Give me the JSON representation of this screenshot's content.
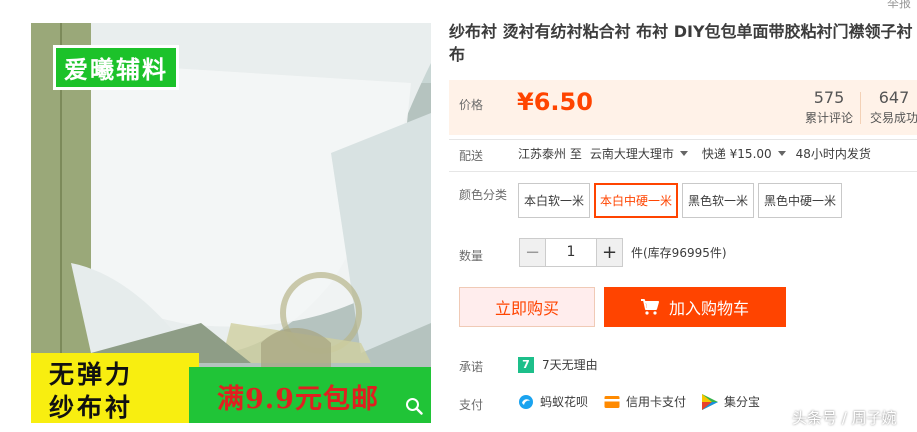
{
  "header": {
    "report_link": "举报"
  },
  "gallery": {
    "brand_badge": "爱曦辅料",
    "promo_line1": "无弹力",
    "promo_line2": "纱布衬",
    "promo_shipping": "满9.9元包邮",
    "zoom_icon": "search-icon"
  },
  "product": {
    "title": "纱布衬 烫衬有纺衬粘合衬 布衬 DIY包包单面带胶粘衬门襟领子衬布"
  },
  "price": {
    "label": "价格",
    "currency": "¥",
    "value": "6.50",
    "reviews_count": "575",
    "reviews_label": "累计评论",
    "sales_count": "647",
    "sales_label": "交易成功"
  },
  "delivery": {
    "label": "配送",
    "from_to": "江苏泰州 至",
    "destination": "云南大理大理市",
    "express": "快递 ¥15.00",
    "ship_time": "48小时内发货"
  },
  "color": {
    "label": "颜色分类",
    "options": [
      "本白软一米",
      "本白中硬一米",
      "黑色软一米",
      "黑色中硬一米"
    ],
    "selected_index": 1
  },
  "quantity": {
    "label": "数量",
    "value": "1",
    "minus": "−",
    "plus": "+",
    "unit_stock": "件(库存96995件)"
  },
  "actions": {
    "buy_now": "立即购买",
    "add_to_cart": "加入购物车"
  },
  "promise": {
    "label": "承诺",
    "icon_text": "7",
    "text": "7天无理由"
  },
  "payment": {
    "label": "支付",
    "methods": [
      "蚂蚁花呗",
      "信用卡支付",
      "集分宝"
    ]
  },
  "watermark": "头条号 / 周子婉",
  "colors": {
    "accent": "#ff4400",
    "price_bg": "#fff2e8",
    "promise_green": "#1dbf8a"
  }
}
